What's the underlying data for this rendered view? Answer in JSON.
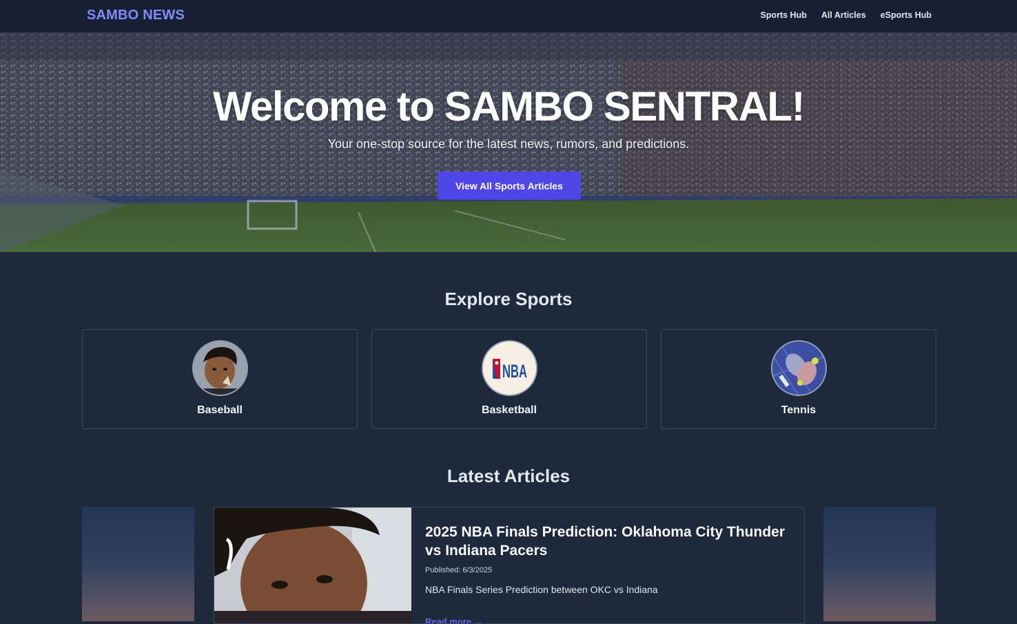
{
  "nav": {
    "brand": "SAMBO NEWS",
    "links": [
      "Sports Hub",
      "All Articles",
      "eSports Hub"
    ]
  },
  "hero": {
    "title": "Welcome to SAMBO SENTRAL!",
    "subtitle": "Your one-stop source for the latest news, rumors, and predictions.",
    "button_label": "View All Sports Articles"
  },
  "explore": {
    "title": "Explore Sports",
    "sports": [
      {
        "label": "Baseball",
        "icon": "portrait-photo"
      },
      {
        "label": "Basketball",
        "icon": "nba-logo",
        "logo_text": "NBA"
      },
      {
        "label": "Tennis",
        "icon": "pickleball-paddles"
      }
    ]
  },
  "latest": {
    "title": "Latest Articles",
    "featured": {
      "title": "2025 NBA Finals Prediction: Oklahoma City Thunder vs Indiana Pacers",
      "published": "Published: 6/3/2025",
      "description": "NBA Finals Series Prediction between OKC vs Indiana",
      "read_more": "Read more →"
    }
  },
  "colors": {
    "accent": "#4f46e5",
    "brand": "#818cf8",
    "background": "#1e293b",
    "nav_background": "#172033"
  }
}
